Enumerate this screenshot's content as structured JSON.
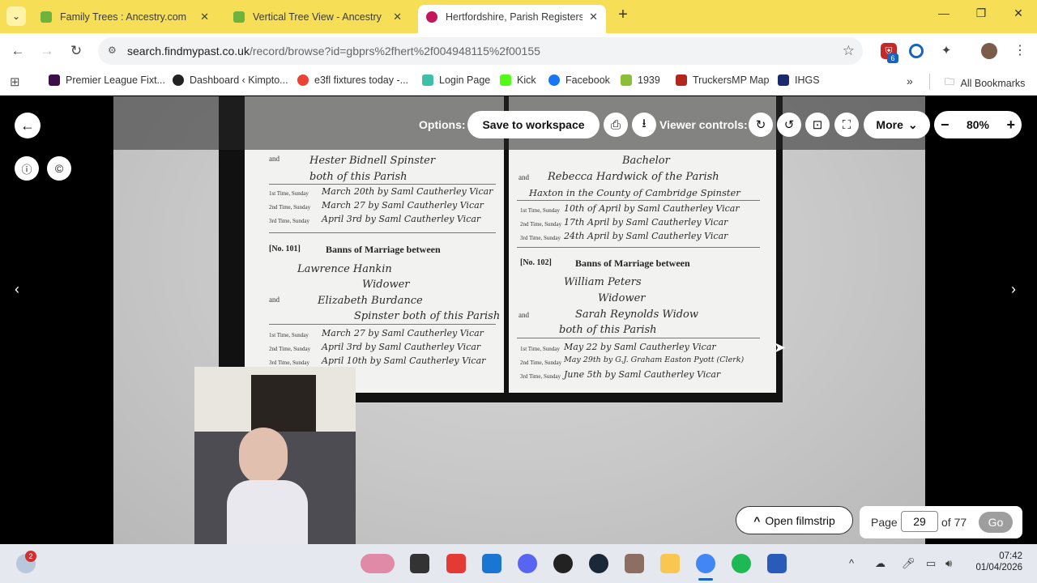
{
  "browser": {
    "tabs": [
      {
        "title": "Family Trees : Ancestry.com",
        "color": "#6fb33f"
      },
      {
        "title": "Vertical Tree View - Ancestry",
        "color": "#6fb33f"
      },
      {
        "title": "Hertfordshire, Parish Registers E",
        "color": "#c2185b"
      }
    ],
    "new_tab_symbol": "+",
    "url_host": "search.findmypast.co.uk",
    "url_path": "/record/browse?id=gbprs%2fhert%2f004948115%2f00155",
    "extension_badge": "6",
    "bookmarks": [
      {
        "label": "Premier League Fixt...",
        "color": "#3d0f4a"
      },
      {
        "label": "Dashboard ‹ Kimpto...",
        "color": "#222"
      },
      {
        "label": "e3fl fixtures today -...",
        "color": "#ea4335"
      },
      {
        "label": "Login Page",
        "color": "#3dbfa8"
      },
      {
        "label": "Kick",
        "color": "#53fc18"
      },
      {
        "label": "Facebook",
        "color": "#1877f2"
      },
      {
        "label": "1939",
        "color": "#8bbf3a"
      },
      {
        "label": "TruckersMP Map",
        "color": "#b3261e"
      },
      {
        "label": "IHGS",
        "color": "#1a2a6c"
      }
    ],
    "all_bookmarks": "All Bookmarks"
  },
  "viewer": {
    "options_label": "Options:",
    "save_label": "Save to workspace",
    "controls_label": "Viewer controls:",
    "more_label": "More",
    "zoom": "80%",
    "open_filmstrip": "Open filmstrip",
    "page_label": "Page",
    "page_value": "29",
    "page_total": "of 77",
    "go_label": "Go"
  },
  "document": {
    "left_page": {
      "top_entry": {
        "and_label": "and",
        "name": "Hester Bidnell Spinster",
        "line2": "both of this Parish",
        "times": [
          "1st Time, Sunday",
          "2nd Time, Sunday",
          "3rd Time, Sunday"
        ],
        "entries": [
          "March 20th by Saml Cautherley Vicar",
          "March 27 by Saml Cautherley Vicar",
          "April 3rd by Saml Cautherley Vicar"
        ]
      },
      "bottom_entry": {
        "number": "[No. 101]",
        "heading": "Banns of Marriage between",
        "groom": "Lawrence Hankin",
        "groom_status": "Widower",
        "and_label": "and",
        "bride": "Elizabeth Burdance",
        "bride_status": "Spinster both of this Parish",
        "entries": [
          "March 27 by Saml Cautherley Vicar",
          "April 3rd by Saml Cautherley Vicar",
          "April 10th by Saml Cautherley Vicar"
        ]
      }
    },
    "right_page": {
      "top_entry": {
        "groom_status": "Bachelor",
        "and_label": "and",
        "bride": "Rebecca Hardwick of the Parish",
        "bride_line2": "Haxton in the County of Cambridge Spinster",
        "entries": [
          "10th of April by Saml Cautherley Vicar",
          "17th April by Saml Cautherley Vicar",
          "24th April by Saml Cautherley Vicar"
        ]
      },
      "bottom_entry": {
        "number": "[No. 102]",
        "heading": "Banns of Marriage between",
        "groom": "William Peters",
        "groom_status": "Widower",
        "and_label": "and",
        "bride": "Sarah Reynolds Widow",
        "bride_line2": "both of this Parish",
        "entries": [
          "May 22 by Saml Cautherley Vicar",
          "May 29th by G.J. Graham Easton Pyott (Clerk)",
          "June 5th by Saml Cautherley Vicar"
        ]
      }
    }
  },
  "taskbar": {
    "weather_badge": "2",
    "time": "07:42",
    "date": "01/04/2026"
  }
}
